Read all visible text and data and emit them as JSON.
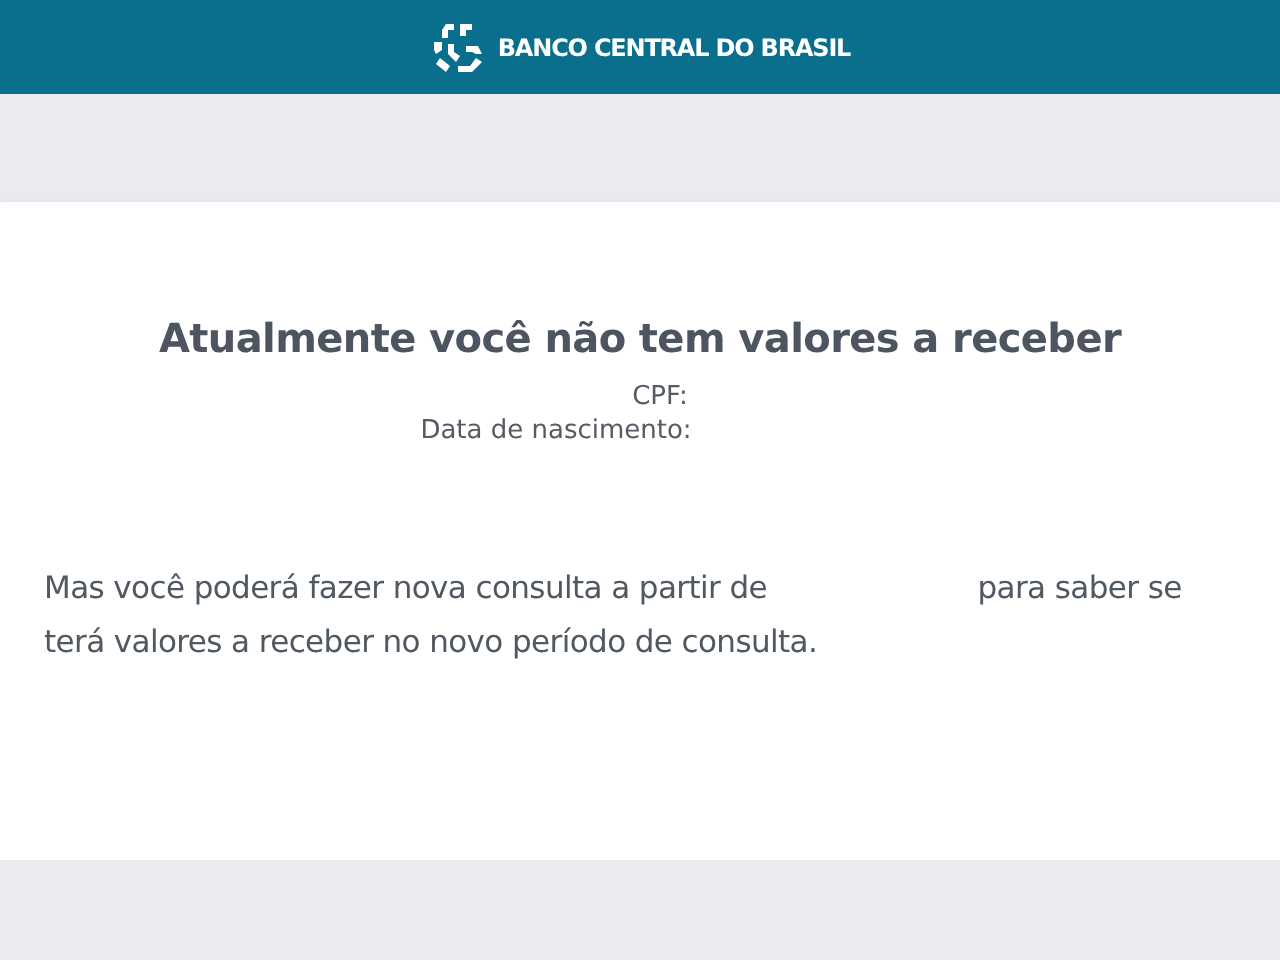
{
  "header": {
    "logo_text": "BANCO CENTRAL DO BRASIL"
  },
  "result": {
    "title": "Atualmente você não tem valores a receber",
    "cpf_label": "CPF:",
    "birth_label": "Data de nascimento:",
    "message_before": "Mas você poderá fazer nova consulta a partir de",
    "message_after": "para saber se terá valores a receber no novo período de consulta."
  }
}
